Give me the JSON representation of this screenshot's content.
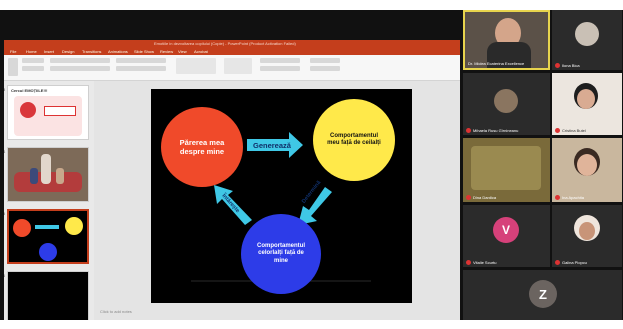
{
  "powerpoint": {
    "window_title": "Emotiile in dezvoltarea copilului (Copie) - PowerPoint (Product Activation Failed)",
    "tabs": [
      "File",
      "Home",
      "Insert",
      "Design",
      "Transitions",
      "Animations",
      "Slide Show",
      "Review",
      "View",
      "Acrobat"
    ],
    "thumbnails": [
      {
        "number": "3",
        "heading": "Cercul EMOȚIILE!!!"
      },
      {
        "number": "4"
      },
      {
        "number": "5"
      },
      {
        "number": "6"
      }
    ],
    "notes_placeholder": "Click to add notes",
    "slide": {
      "circles": {
        "red": "Părerea mea despre mine",
        "yellow": "Comportamentul meu față de ceilalți",
        "blue": "Comportamentul celorlalți față de mine"
      },
      "arrows": {
        "top": "Generează",
        "right": "Determină",
        "left": "Întărește"
      },
      "colors": {
        "red": "#f04a2a",
        "yellow": "#ffe94a",
        "blue": "#2d3ce8",
        "arrow": "#3fc8e6"
      }
    }
  },
  "participants": [
    {
      "name": "Dr. Miclea Ecaterina Excellence",
      "muted": false
    },
    {
      "name": "Ilona Bica",
      "muted": true
    },
    {
      "name": "Mihaela Rusu Gîrnineanu",
      "muted": true
    },
    {
      "name": "Cristina Butel",
      "muted": true
    },
    {
      "name": "Dina Dardica",
      "muted": true
    },
    {
      "name": "Ina Apachita",
      "muted": true
    },
    {
      "name": "Vitalie Scurtu",
      "muted": true,
      "initial": "V"
    },
    {
      "name": "Galina Plopcu",
      "muted": true
    },
    {
      "name": "",
      "initial": "Z"
    }
  ]
}
